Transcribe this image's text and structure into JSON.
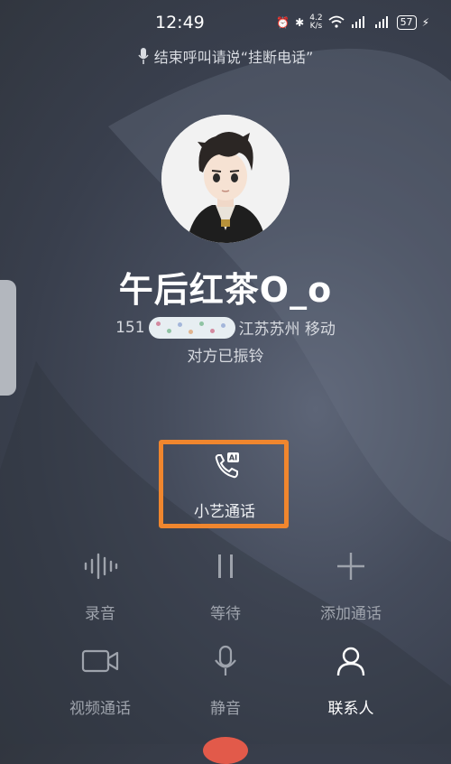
{
  "status_bar": {
    "time": "12:49",
    "net_speed_value": "4.2",
    "net_speed_unit": "K/s",
    "battery": "57"
  },
  "hint": "结束呼叫请说“挂断电话”",
  "contact": {
    "name": "午后红茶O_o",
    "number_prefix": "151",
    "location": "江苏苏州 移动",
    "status": "对方已振铃"
  },
  "ai_call": {
    "label": "小艺通话",
    "badge": "AI"
  },
  "controls": {
    "record": "录音",
    "hold": "等待",
    "add_call": "添加通话",
    "video_call": "视频通话",
    "mute": "静音",
    "contacts": "联系人"
  },
  "colors": {
    "highlight_box": "#f0862e",
    "end_call": "#e25a4a"
  }
}
